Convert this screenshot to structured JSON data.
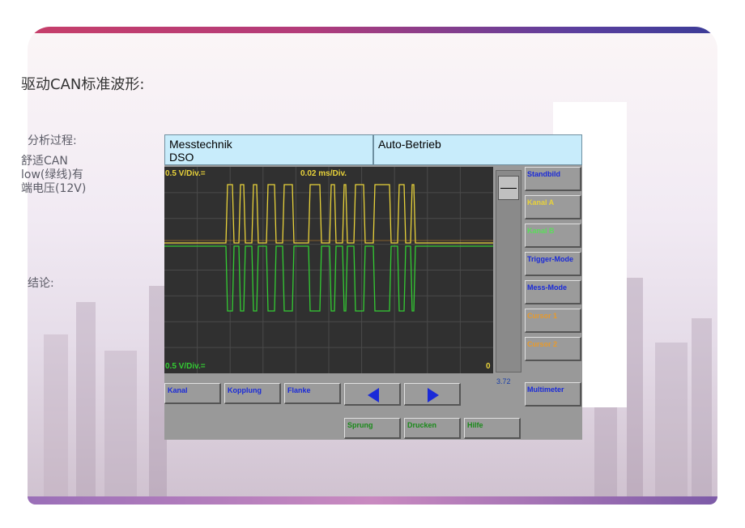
{
  "slide": {
    "title": "驱动CAN标准波形:",
    "analysis_label": "分析过程:",
    "body_text": "舒适CAN\nlow(绿线)有\n端电压(12V)",
    "conclusion_label": "结论:"
  },
  "scope": {
    "header_left": {
      "line1": "Messtechnik",
      "line2": "DSO"
    },
    "header_right": "Auto-Betrieb",
    "channel_a_scale": "0.5 V/Div.=",
    "time_scale": "0.02 ms/Div.",
    "channel_b_scale": "0.5 V/Div.=",
    "zero_marker": "0",
    "slider_value": "3.72",
    "side_buttons": [
      {
        "label": "Standbild",
        "color": "#1a2ad8"
      },
      {
        "label": "Kanal A",
        "color": "#e8d23a"
      },
      {
        "label": "Kanal B",
        "color": "#5ade5a"
      },
      {
        "label": "Trigger-Mode",
        "color": "#1a2ad8"
      },
      {
        "label": "Mess-Mode",
        "color": "#1a2ad8"
      },
      {
        "label": "Cursor 1",
        "color": "#e89a2a"
      },
      {
        "label": "Cursor 2",
        "color": "#e89a2a"
      },
      {
        "label": "Multimeter",
        "color": "#1a2ad8"
      }
    ],
    "bottom_buttons": [
      {
        "label": "Kanal"
      },
      {
        "label": "Kopplung"
      },
      {
        "label": "Flanke"
      }
    ],
    "bottom_buttons_row2": [
      {
        "label": "Sprung"
      },
      {
        "label": "Drucken"
      },
      {
        "label": "Hilfe"
      }
    ],
    "icons": {
      "prev": "left-arrow-icon",
      "next": "right-arrow-icon"
    },
    "colors": {
      "channel_a": "#e8d23a",
      "channel_b": "#33cc33",
      "header_bg": "#c8ecfb",
      "grid": "#4a4a4a"
    }
  }
}
